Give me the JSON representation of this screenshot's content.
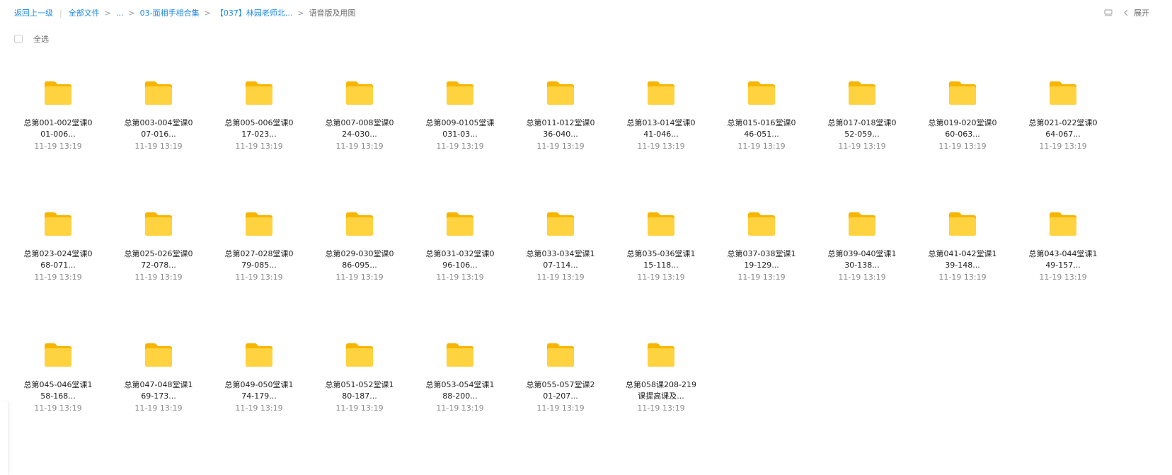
{
  "breadcrumb": {
    "back_label": "返回上一级",
    "pipe": "|",
    "sep": ">",
    "crumbs": [
      {
        "label": "全部文件"
      },
      {
        "label": "..."
      },
      {
        "label": "03-面相手相合集"
      },
      {
        "label": "【037】林园老师北..."
      }
    ],
    "current": "语音版及用图"
  },
  "toolbar": {
    "expand_label": "展开",
    "sidebar_toggle_icon": "panel-toggle-icon",
    "chevron_icon": "chevron-left-icon"
  },
  "select_all": {
    "label": "全选",
    "checked": false
  },
  "colors": {
    "link": "#1e88e5",
    "folder_back": "#f7b500",
    "folder_front": "#ffd23f"
  },
  "folders": [
    {
      "name": "总第001-002堂课001-006...",
      "date": "11-19 13:19"
    },
    {
      "name": "总第003-004堂课007-016...",
      "date": "11-19 13:19"
    },
    {
      "name": "总第005-006堂课017-023...",
      "date": "11-19 13:19"
    },
    {
      "name": "总第007-008堂课024-030...",
      "date": "11-19 13:19"
    },
    {
      "name": "总第009-0105堂课031-03...",
      "date": "11-19 13:19"
    },
    {
      "name": "总第011-012堂课036-040...",
      "date": "11-19 13:19"
    },
    {
      "name": "总第013-014堂课041-046...",
      "date": "11-19 13:19"
    },
    {
      "name": "总第015-016堂课046-051...",
      "date": "11-19 13:19"
    },
    {
      "name": "总第017-018堂课052-059...",
      "date": "11-19 13:19"
    },
    {
      "name": "总第019-020堂课060-063...",
      "date": "11-19 13:19"
    },
    {
      "name": "总第021-022堂课064-067...",
      "date": "11-19 13:19"
    },
    {
      "name": "总第023-024堂课068-071...",
      "date": "11-19 13:19"
    },
    {
      "name": "总第025-026堂课072-078...",
      "date": "11-19 13:19"
    },
    {
      "name": "总第027-028堂课079-085...",
      "date": "11-19 13:19"
    },
    {
      "name": "总第029-030堂课086-095...",
      "date": "11-19 13:19"
    },
    {
      "name": "总第031-032堂课096-106...",
      "date": "11-19 13:19"
    },
    {
      "name": "总第033-034堂课107-114...",
      "date": "11-19 13:19"
    },
    {
      "name": "总第035-036堂课115-118...",
      "date": "11-19 13:19"
    },
    {
      "name": "总第037-038堂课119-129...",
      "date": "11-19 13:19"
    },
    {
      "name": "总第039-040堂课130-138...",
      "date": "11-19 13:19"
    },
    {
      "name": "总第041-042堂课139-148...",
      "date": "11-19 13:19"
    },
    {
      "name": "总第043-044堂课149-157...",
      "date": "11-19 13:19"
    },
    {
      "name": "总第045-046堂课158-168...",
      "date": "11-19 13:19"
    },
    {
      "name": "总第047-048堂课169-173...",
      "date": "11-19 13:19"
    },
    {
      "name": "总第049-050堂课174-179...",
      "date": "11-19 13:19"
    },
    {
      "name": "总第051-052堂课180-187...",
      "date": "11-19 13:19"
    },
    {
      "name": "总第053-054堂课188-200...",
      "date": "11-19 13:19"
    },
    {
      "name": "总第055-057堂课201-207...",
      "date": "11-19 13:19"
    },
    {
      "name": "总第058课208-219课提高课及...",
      "date": "11-19 13:19"
    }
  ]
}
